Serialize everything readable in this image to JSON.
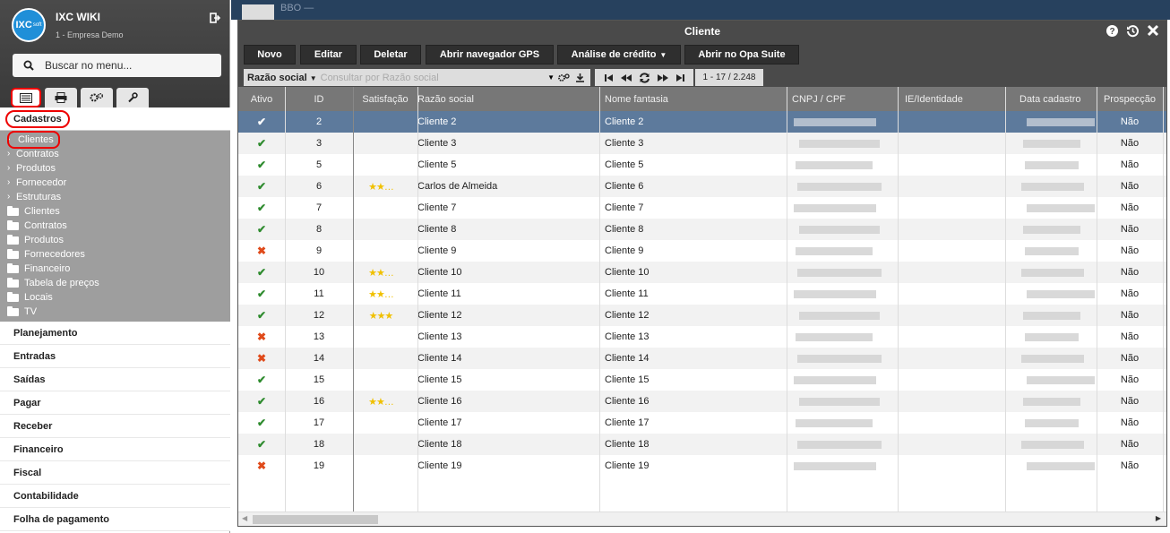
{
  "sidebar": {
    "app_title": "IXC WIKI",
    "company": "1 - Empresa Demo",
    "logo_text": "IXC",
    "logo_sub": "soft",
    "search_placeholder": "Buscar no menu...",
    "section_open": "Cadastros",
    "subitems": [
      "Clientes",
      "Contratos",
      "Produtos",
      "Fornecedor",
      "Estruturas"
    ],
    "folders": [
      "Clientes",
      "Contratos",
      "Produtos",
      "Fornecedores",
      "Financeiro",
      "Tabela de preços",
      "Locais",
      "TV"
    ],
    "sections": [
      "Planejamento",
      "Entradas",
      "Saídas",
      "Pagar",
      "Receber",
      "Financeiro",
      "Fiscal",
      "Contabilidade",
      "Folha de pagamento"
    ]
  },
  "background": {
    "partial_title": "BBO —"
  },
  "window": {
    "title": "Cliente",
    "buttons": {
      "novo": "Novo",
      "editar": "Editar",
      "deletar": "Deletar",
      "gps": "Abrir navegador GPS",
      "credito": "Análise de crédito",
      "opa": "Abrir no Opa Suite"
    },
    "filter": {
      "field": "Razão social",
      "placeholder": "Consultar por Razão social"
    },
    "page_info": "1 - 17 / 2.248"
  },
  "columns": [
    "Ativo",
    "ID",
    "Satisfação",
    "Razão social",
    "Nome fantasia",
    "CNPJ / CPF",
    "IE/Identidade",
    "Data cadastro",
    "Prospecção"
  ],
  "rows": [
    {
      "ativo": "✔",
      "ok": true,
      "id": "2",
      "sat": "",
      "razao": "Cliente 2",
      "nome": "Cliente 2",
      "prosp": "Não"
    },
    {
      "ativo": "✔",
      "ok": true,
      "id": "3",
      "sat": "",
      "razao": "Cliente 3",
      "nome": "Cliente 3",
      "prosp": "Não"
    },
    {
      "ativo": "✔",
      "ok": true,
      "id": "5",
      "sat": "",
      "razao": "Cliente 5",
      "nome": "Cliente 5",
      "prosp": "Não"
    },
    {
      "ativo": "✔",
      "ok": true,
      "id": "6",
      "sat": "★★…",
      "razao": "Carlos de Almeida",
      "nome": "Cliente 6",
      "prosp": "Não"
    },
    {
      "ativo": "✔",
      "ok": true,
      "id": "7",
      "sat": "",
      "razao": "Cliente 7",
      "nome": "Cliente 7",
      "prosp": "Não"
    },
    {
      "ativo": "✔",
      "ok": true,
      "id": "8",
      "sat": "",
      "razao": "Cliente 8",
      "nome": "Cliente 8",
      "prosp": "Não"
    },
    {
      "ativo": "✖",
      "ok": false,
      "id": "9",
      "sat": "",
      "razao": "Cliente 9",
      "nome": "Cliente 9",
      "prosp": "Não"
    },
    {
      "ativo": "✔",
      "ok": true,
      "id": "10",
      "sat": "★★…",
      "razao": "Cliente 10",
      "nome": "Cliente 10",
      "prosp": "Não"
    },
    {
      "ativo": "✔",
      "ok": true,
      "id": "11",
      "sat": "★★…",
      "razao": "Cliente 11",
      "nome": "Cliente 11",
      "prosp": "Não"
    },
    {
      "ativo": "✔",
      "ok": true,
      "id": "12",
      "sat": "★★★",
      "razao": "Cliente 12",
      "nome": "Cliente 12",
      "prosp": "Não"
    },
    {
      "ativo": "✖",
      "ok": false,
      "id": "13",
      "sat": "",
      "razao": "Cliente 13",
      "nome": "Cliente 13",
      "prosp": "Não"
    },
    {
      "ativo": "✖",
      "ok": false,
      "id": "14",
      "sat": "",
      "razao": "Cliente 14",
      "nome": "Cliente 14",
      "prosp": "Não"
    },
    {
      "ativo": "✔",
      "ok": true,
      "id": "15",
      "sat": "",
      "razao": "Cliente 15",
      "nome": "Cliente 15",
      "prosp": "Não"
    },
    {
      "ativo": "✔",
      "ok": true,
      "id": "16",
      "sat": "★★…",
      "razao": "Cliente 16",
      "nome": "Cliente 16",
      "prosp": "Não"
    },
    {
      "ativo": "✔",
      "ok": true,
      "id": "17",
      "sat": "",
      "razao": "Cliente 17",
      "nome": "Cliente 17",
      "prosp": "Não"
    },
    {
      "ativo": "✔",
      "ok": true,
      "id": "18",
      "sat": "",
      "razao": "Cliente 18",
      "nome": "Cliente 18",
      "prosp": "Não"
    },
    {
      "ativo": "✖",
      "ok": false,
      "id": "19",
      "sat": "",
      "razao": "Cliente 19",
      "nome": "Cliente 19",
      "prosp": "Não"
    }
  ],
  "colors": {
    "check": "#2e8b2e",
    "cross": "#e04a1a",
    "selected_row": "#5d7a9c",
    "star": "#f0c000"
  }
}
